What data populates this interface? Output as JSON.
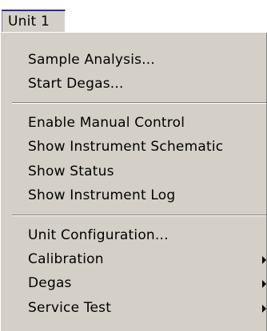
{
  "menubar": {
    "unit_label": "Unit 1"
  },
  "menu": {
    "items": [
      {
        "label": "Sample Analysis...",
        "has_submenu": false
      },
      {
        "label": "Start Degas...",
        "has_submenu": false
      },
      {
        "label": "Enable Manual Control",
        "has_submenu": false
      },
      {
        "label": "Show Instrument Schematic",
        "has_submenu": false
      },
      {
        "label": "Show Status",
        "has_submenu": false
      },
      {
        "label": "Show Instrument Log",
        "has_submenu": false
      },
      {
        "label": "Unit Configuration...",
        "has_submenu": false
      },
      {
        "label": "Calibration",
        "has_submenu": true
      },
      {
        "label": "Degas",
        "has_submenu": true
      },
      {
        "label": "Service Test",
        "has_submenu": true
      }
    ]
  }
}
